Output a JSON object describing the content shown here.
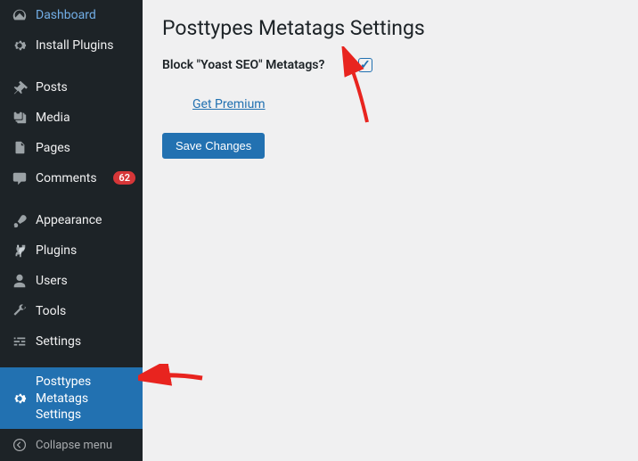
{
  "sidebar": {
    "items": [
      {
        "label": "Dashboard"
      },
      {
        "label": "Install Plugins"
      },
      {
        "label": "Posts"
      },
      {
        "label": "Media"
      },
      {
        "label": "Pages"
      },
      {
        "label": "Comments",
        "badge": "62"
      },
      {
        "label": "Appearance"
      },
      {
        "label": "Plugins"
      },
      {
        "label": "Users"
      },
      {
        "label": "Tools"
      },
      {
        "label": "Settings"
      },
      {
        "label": "Posttypes Metatags Settings"
      }
    ],
    "collapse_label": "Collapse menu"
  },
  "page": {
    "title": "Posttypes Metatags Settings",
    "block_label": "Block \"Yoast SEO\" Metatags?",
    "premium_label": "Get Premium",
    "save_label": "Save Changes"
  }
}
